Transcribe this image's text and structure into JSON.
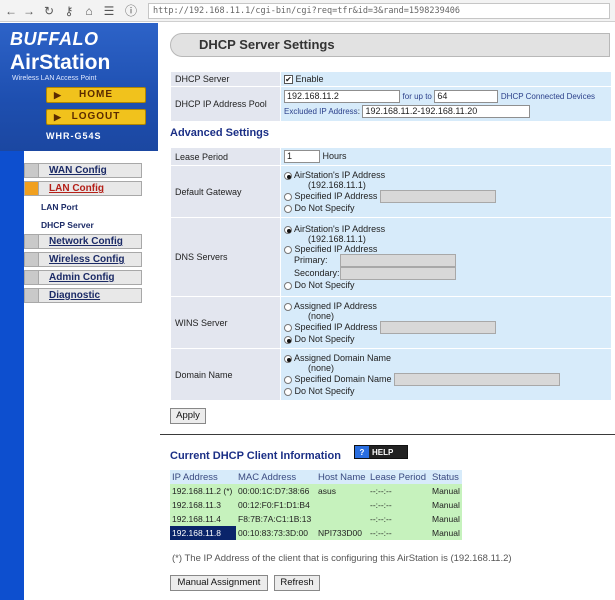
{
  "browser": {
    "url": "http://192.168.11.1/cgi-bin/cgi?req=tfr&id=3&rand=1598239406"
  },
  "sidebar": {
    "brand": "BUFFALO",
    "product": "AirStation",
    "subtitle": "Wireless LAN Access Point",
    "home_label": "HOME",
    "logout_label": "LOGOUT",
    "model": "WHR-G54S",
    "nav": [
      {
        "label": "WAN Config"
      },
      {
        "label": "LAN Config"
      },
      {
        "label": "Network Config"
      },
      {
        "label": "Wireless Config"
      },
      {
        "label": "Admin Config"
      },
      {
        "label": "Diagnostic"
      }
    ],
    "sub_nav": [
      "LAN Port",
      "DHCP Server"
    ]
  },
  "page": {
    "title": "DHCP Server Settings"
  },
  "dhcp": {
    "server_label": "DHCP Server",
    "enable_label": "Enable",
    "pool_label": "DHCP IP Address Pool",
    "pool_start": "192.168.11.2",
    "for_up_to": "for up to",
    "pool_count": "64",
    "connected_devices": "DHCP Connected Devices",
    "excluded_label": "Excluded IP Address",
    "excluded_value": "192.168.11.2-192.168.11.20"
  },
  "advanced": {
    "heading": "Advanced Settings",
    "lease_label": "Lease Period",
    "lease_value": "1",
    "lease_unit": "Hours",
    "gateway_label": "Default Gateway",
    "gateway_opt1": "AirStation's IP Address",
    "gateway_opt1_ip": "(192.168.11.1)",
    "gateway_opt2": "Specified IP Address",
    "gateway_opt3": "Do Not Specify",
    "dns_label": "DNS Servers",
    "dns_opt1": "AirStation's IP Address",
    "dns_opt1_ip": "(192.168.11.1)",
    "dns_opt2": "Specified IP Address",
    "dns_primary": "Primary:",
    "dns_secondary": "Secondary:",
    "dns_opt3": "Do Not Specify",
    "wins_label": "WINS Server",
    "wins_opt1": "Assigned IP Address",
    "wins_opt1_sub": "(none)",
    "wins_opt2": "Specified IP Address",
    "wins_opt3": "Do Not Specify",
    "domain_label": "Domain Name",
    "domain_opt1": "Assigned Domain Name",
    "domain_opt1_sub": "(none)",
    "domain_opt2": "Specified Domain Name",
    "domain_opt3": "Do Not Specify",
    "apply_label": "Apply"
  },
  "clients": {
    "heading": "Current DHCP Client Information",
    "help_label": "HELP",
    "columns": [
      "IP Address",
      "MAC Address",
      "Host Name",
      "Lease Period",
      "Status"
    ],
    "rows": [
      {
        "ip": "192.168.11.2 (*)",
        "mac": "00:00:1C:D7:38:66",
        "host": "asus",
        "lease": "--:--:--",
        "status": "Manual"
      },
      {
        "ip": "192.168.11.3",
        "mac": "00:12:F0:F1:D1:B4",
        "host": "",
        "lease": "--:--:--",
        "status": "Manual"
      },
      {
        "ip": "192.168.11.4",
        "mac": "F8:7B:7A:C1:1B:13",
        "host": "",
        "lease": "--:--:--",
        "status": "Manual"
      },
      {
        "ip": "192.168.11.8",
        "mac": "00:10:83:73:3D:00",
        "host": "NPI733D00",
        "lease": "--:--:--",
        "status": "Manual"
      }
    ],
    "note": "(*) The IP Address of the client that is configuring this AirStation is (192.168.11.2)",
    "manual_label": "Manual Assignment",
    "refresh_label": "Refresh"
  }
}
